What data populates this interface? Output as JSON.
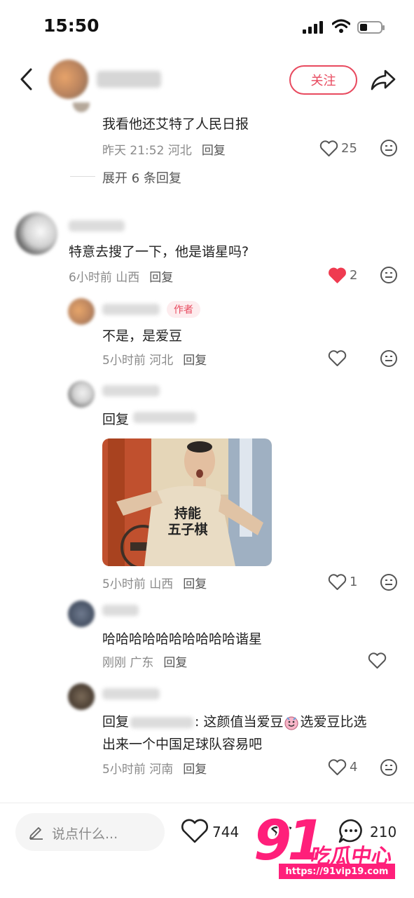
{
  "status_bar": {
    "time": "15:50"
  },
  "header": {
    "follow_label": "关注"
  },
  "comments": [
    {
      "text": "我看他还艾特了人民日报",
      "time": "昨天 21:52",
      "location": "河北",
      "reply_label": "回复",
      "likes": "25"
    },
    {
      "expand_label": "展开 6 条回复"
    },
    {
      "text": "特意去搜了一下，他是谐星吗?",
      "time": "6小时前",
      "location": "山西",
      "reply_label": "回复",
      "likes": "2",
      "liked": true
    },
    {
      "author_tag": "作者",
      "text": "不是，是爱豆",
      "time": "5小时前",
      "location": "河北",
      "reply_label": "回复"
    },
    {
      "text_prefix": "回复",
      "time": "5小时前",
      "location": "山西",
      "reply_label": "回复",
      "likes": "1",
      "image_shirt_text": "持能 五子棋"
    },
    {
      "text": "哈哈哈哈哈哈哈哈哈哈谐星",
      "time": "刚刚",
      "location": "广东",
      "reply_label": "回复"
    },
    {
      "text_prefix": "回复",
      "text_line1": ": 这颜值当爱豆",
      "text_line1b": "选爱豆比选",
      "text_line2": "出来一个中国足球队容易吧",
      "time": "5小时前",
      "location": "河南",
      "reply_label": "回复",
      "likes": "4"
    }
  ],
  "bottom_bar": {
    "placeholder": "说点什么...",
    "likes": "744",
    "comments": "210"
  },
  "watermark": {
    "number": "91",
    "text": "吃瓜中心",
    "url": "https://91vip19.com"
  },
  "colors": {
    "accent": "#e84a5f",
    "watermark": "#ff1f7a"
  }
}
